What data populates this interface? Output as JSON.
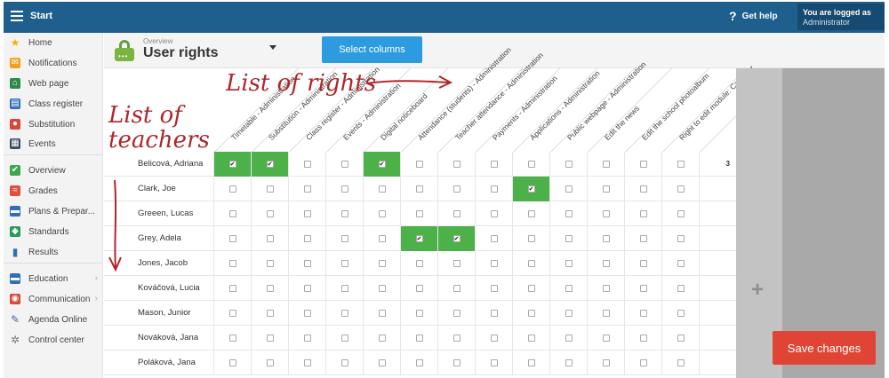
{
  "topbar": {
    "title": "Start",
    "help_label": "Get help",
    "user_line1": "You are logged as",
    "user_line2": "Administrator"
  },
  "sidebar": {
    "items": [
      {
        "label": "Home",
        "icon": "star-icon",
        "color": "#f0b400"
      },
      {
        "label": "Notifications",
        "icon": "envelope-icon",
        "color": "#f0a020"
      },
      {
        "label": "Web page",
        "icon": "house-icon",
        "color": "#2a8a4a"
      },
      {
        "label": "Class register",
        "icon": "book-icon",
        "color": "#2f6fb8"
      },
      {
        "label": "Substitution",
        "icon": "substitute-person-icon",
        "color": "#d9463a"
      },
      {
        "label": "Events",
        "icon": "calendar-icon",
        "color": "#3a4a5a"
      },
      {
        "label": "Overview",
        "icon": "check-circle-icon",
        "color": "#3aa84a"
      },
      {
        "label": "Grades",
        "icon": "grades-icon",
        "color": "#e0503a"
      },
      {
        "label": "Plans & Prepar...",
        "icon": "briefcase-icon",
        "color": "#2f6fb8"
      },
      {
        "label": "Standards",
        "icon": "shield-icon",
        "color": "#2a9a5a"
      },
      {
        "label": "Results",
        "icon": "bar-chart-icon",
        "color": "#2f6fb8"
      },
      {
        "label": "Education",
        "icon": "suitcase-icon",
        "color": "#2f6fb8"
      },
      {
        "label": "Communication",
        "icon": "chat-icon",
        "color": "#d9463a"
      },
      {
        "label": "Agenda Online",
        "icon": "pen-icon",
        "color": "#5a5aa8"
      },
      {
        "label": "Control center",
        "icon": "gear-icon",
        "color": "#7a7a7a"
      }
    ]
  },
  "header": {
    "breadcrumb": "Overview",
    "title": "User rights",
    "select_columns_label": "Select columns"
  },
  "columns": [
    "Timetable - Administration",
    "Substitution - Administration",
    "Class register - Administration",
    "Events - Administration",
    "Digital noticeboard",
    "Attendance (students) - Administration",
    "Teacher attendance - Administration",
    "Payments - Administration",
    "Applications - Administration",
    "Public webpage - Administration",
    "Edit the news",
    "Edit the school photoalbum",
    "Right to edit module: Calendar"
  ],
  "rows": [
    {
      "name": "Belicová, Adriana",
      "checked": [
        0,
        1,
        4
      ],
      "count": "3"
    },
    {
      "name": "Clark, Joe",
      "checked": [
        8
      ],
      "count": ""
    },
    {
      "name": "Greeen, Lucas",
      "checked": [],
      "count": ""
    },
    {
      "name": "Grey, Adela",
      "checked": [
        5,
        6
      ],
      "count": ""
    },
    {
      "name": "Jones, Jacob",
      "checked": [],
      "count": ""
    },
    {
      "name": "Kováčová, Lucia",
      "checked": [],
      "count": ""
    },
    {
      "name": "Mason, Junior",
      "checked": [],
      "count": ""
    },
    {
      "name": "Nováková, Jana",
      "checked": [],
      "count": ""
    },
    {
      "name": "Poláková, Jana",
      "checked": [],
      "count": ""
    }
  ],
  "actions": {
    "add_column_symbol": "+",
    "save_label": "Save changes"
  },
  "annotations": {
    "rights": "List of rights",
    "teachers_line1": "List of",
    "teachers_line2": "teachers"
  }
}
